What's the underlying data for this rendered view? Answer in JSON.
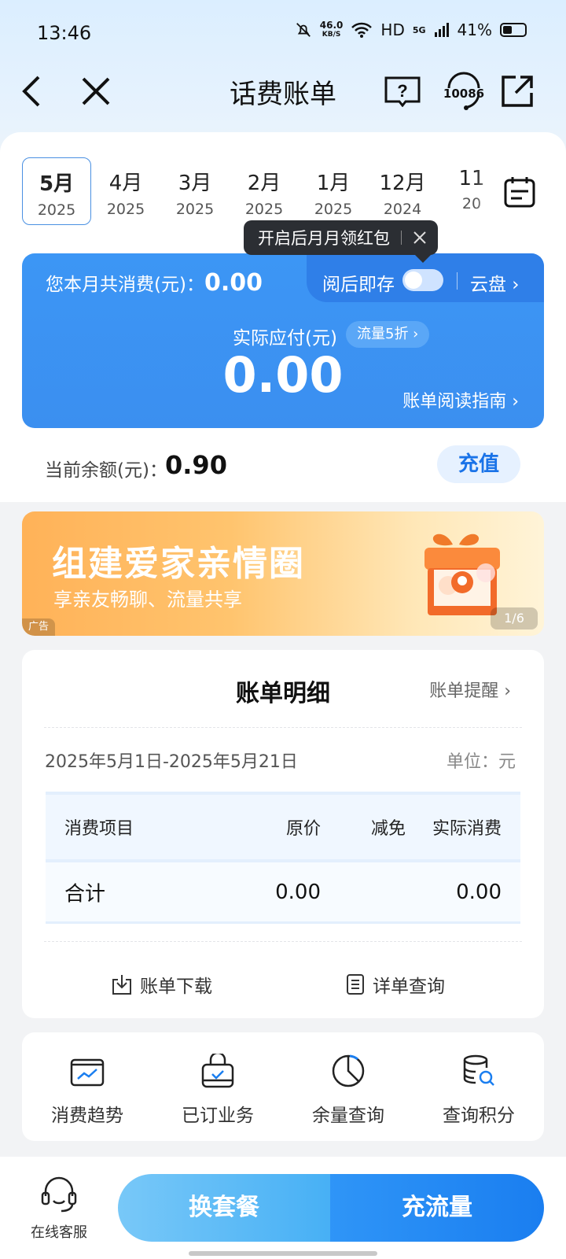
{
  "status": {
    "time": "13:46",
    "net_speed": "46.0",
    "net_unit": "KB/S",
    "hd": "HD",
    "signal": "5G",
    "battery": "41%"
  },
  "header": {
    "title": "话费账单",
    "service_number": "10086"
  },
  "months": [
    {
      "m": "5月",
      "y": "2025"
    },
    {
      "m": "4月",
      "y": "2025"
    },
    {
      "m": "3月",
      "y": "2025"
    },
    {
      "m": "2月",
      "y": "2025"
    },
    {
      "m": "1月",
      "y": "2025"
    },
    {
      "m": "12月",
      "y": "2024"
    },
    {
      "m": "11",
      "y": "20"
    }
  ],
  "tooltip": {
    "text": "开启后月月领红包"
  },
  "bill": {
    "spend_label": "您本月共消费(元)：",
    "spend_value": "0.00",
    "save_label": "阅后即存",
    "cloud_label": "云盘 ›",
    "actual_label": "实际应付(元)",
    "flow_badge": "流量5折 ›",
    "actual_amount": "0.00",
    "guide_link": "账单阅读指南 ›",
    "balance_label": "当前余额(元)：",
    "balance_value": "0.90",
    "recharge": "充值"
  },
  "ad": {
    "title": "组建爱家亲情圈",
    "subtitle": "享亲友畅聊、流量共享",
    "tag": "广告",
    "page": "1/6"
  },
  "detail": {
    "title": "账单明细",
    "remind": "账单提醒 ›",
    "period": "2025年5月1日-2025年5月21日",
    "unit": "单位：元",
    "headers": [
      "消费项目",
      "原价",
      "减免",
      "实际消费"
    ],
    "total": {
      "label": "合计",
      "original": "0.00",
      "discount": "",
      "actual": "0.00"
    },
    "download": "账单下载",
    "query": "详单查询"
  },
  "services": [
    {
      "label": "消费趋势",
      "icon": "trend-icon"
    },
    {
      "label": "已订业务",
      "icon": "subscribed-icon"
    },
    {
      "label": "余量查询",
      "icon": "balance-pie-icon"
    },
    {
      "label": "查询积分",
      "icon": "points-icon"
    }
  ],
  "bottom": {
    "service": "在线客服",
    "change_plan": "换套餐",
    "buy_data": "充流量"
  },
  "colors": {
    "primary_blue": "#3b8ff0",
    "accent_blue": "#1a7ef0",
    "ad_orange": "#ffb258"
  }
}
